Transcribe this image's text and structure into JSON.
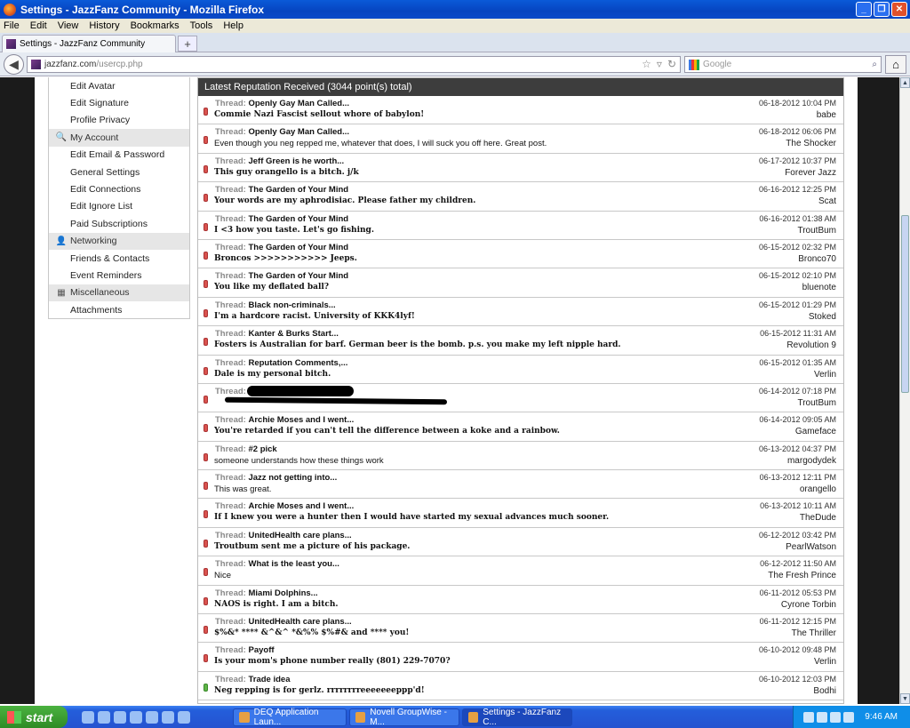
{
  "window": {
    "title": "Settings - JazzFanz Community - Mozilla Firefox"
  },
  "menu": [
    "File",
    "Edit",
    "View",
    "History",
    "Bookmarks",
    "Tools",
    "Help"
  ],
  "tab": {
    "label": "Settings - JazzFanz Community",
    "new_tab": "+"
  },
  "nav": {
    "url_domain": "jazzfanz.com",
    "url_path": "/usercp.php",
    "search_placeholder": "Google"
  },
  "sidebar": [
    {
      "label": "Edit Avatar",
      "head": false
    },
    {
      "label": "Edit Signature",
      "head": false
    },
    {
      "label": "Profile Privacy",
      "head": false
    },
    {
      "label": "My Account",
      "head": true,
      "icon": "key-icon"
    },
    {
      "label": "Edit Email & Password",
      "head": false
    },
    {
      "label": "General Settings",
      "head": false
    },
    {
      "label": "Edit Connections",
      "head": false
    },
    {
      "label": "Edit Ignore List",
      "head": false
    },
    {
      "label": "Paid Subscriptions",
      "head": false
    },
    {
      "label": "Networking",
      "head": true,
      "icon": "people-icon"
    },
    {
      "label": "Friends & Contacts",
      "head": false
    },
    {
      "label": "Event Reminders",
      "head": false
    },
    {
      "label": "Miscellaneous",
      "head": true,
      "icon": "misc-icon"
    },
    {
      "label": "Attachments",
      "head": false
    }
  ],
  "reputation": {
    "header": "Latest Reputation Received (3044 point(s) total)",
    "thread_label": "Thread:",
    "rows": [
      {
        "thread": "Openly Gay Man Called...",
        "message": "Commie Nazi Fascist sellout whore of babylon!",
        "date": "06-18-2012 10:04 PM",
        "user": "babe",
        "bold": true,
        "positive": false
      },
      {
        "thread": "Openly Gay Man Called...",
        "message": "Even though you neg repped me, whatever that does, I will suck you off here. Great post.",
        "date": "06-18-2012 06:06 PM",
        "user": "The Shocker",
        "bold": false,
        "positive": false
      },
      {
        "thread": "Jeff Green is he worth...",
        "message": "This guy orangello is a bitch. j/k",
        "date": "06-17-2012 10:37 PM",
        "user": "Forever Jazz",
        "bold": true,
        "positive": false
      },
      {
        "thread": "The Garden of Your Mind",
        "message": "Your words are my aphrodisiac. Please father my children.",
        "date": "06-16-2012 12:25 PM",
        "user": "Scat",
        "bold": true,
        "positive": false
      },
      {
        "thread": "The Garden of Your Mind",
        "message": "I <3 how you taste. Let's go fishing.",
        "date": "06-16-2012 01:38 AM",
        "user": "TroutBum",
        "bold": true,
        "positive": false
      },
      {
        "thread": "The Garden of Your Mind",
        "message": "Broncos >>>>>>>>>>> Jeeps.",
        "date": "06-15-2012 02:32 PM",
        "user": "Bronco70",
        "bold": true,
        "positive": false
      },
      {
        "thread": "The Garden of Your Mind",
        "message": "You like my deflated ball?",
        "date": "06-15-2012 02:10 PM",
        "user": "bluenote",
        "bold": true,
        "positive": false
      },
      {
        "thread": "Black non-criminals...",
        "message": "I'm a hardcore racist. University of KKK4lyf!",
        "date": "06-15-2012 01:29 PM",
        "user": "Stoked",
        "bold": true,
        "positive": false
      },
      {
        "thread": "Kanter & Burks Start...",
        "message": "Fosters is Australian for barf. German beer is the bomb. p.s. you make my left nipple hard.",
        "date": "06-15-2012 11:31 AM",
        "user": "Revolution 9",
        "bold": true,
        "positive": false
      },
      {
        "thread": "Reputation Comments,...",
        "message": "Dale is my personal bitch.",
        "date": "06-15-2012 01:35 AM",
        "user": "Verlin",
        "bold": true,
        "positive": false
      },
      {
        "thread": "",
        "message": "",
        "date": "06-14-2012 07:18 PM",
        "user": "TroutBum",
        "bold": true,
        "positive": false,
        "redacted": true
      },
      {
        "thread": "Archie Moses and I went...",
        "message": "You're retarded if you can't tell the difference between a koke and a rainbow.",
        "date": "06-14-2012 09:05 AM",
        "user": "Gameface",
        "bold": true,
        "positive": false
      },
      {
        "thread": "#2 pick",
        "message": "someone understands how these things work",
        "date": "06-13-2012 04:37 PM",
        "user": "margodydek",
        "bold": false,
        "positive": false
      },
      {
        "thread": "Jazz not getting into...",
        "message": "This was great.",
        "date": "06-13-2012 12:11 PM",
        "user": "orangello",
        "bold": false,
        "positive": false
      },
      {
        "thread": "Archie Moses and I went...",
        "message": "If I knew you were a hunter then I would have started my sexual advances much sooner.",
        "date": "06-13-2012 10:11 AM",
        "user": "TheDude",
        "bold": true,
        "positive": false
      },
      {
        "thread": "UnitedHealth care plans...",
        "message": "Troutbum sent me a picture of his package.",
        "date": "06-12-2012 03:42 PM",
        "user": "PearlWatson",
        "bold": true,
        "positive": false
      },
      {
        "thread": "What is the least you...",
        "message": "Nice",
        "date": "06-12-2012 11:50 AM",
        "user": "The Fresh Prince",
        "bold": false,
        "positive": false
      },
      {
        "thread": "Miami Dolphins...",
        "message": "NAOS is right. I am a bitch.",
        "date": "06-11-2012 05:53 PM",
        "user": "Cyrone Torbin",
        "bold": true,
        "positive": false
      },
      {
        "thread": "UnitedHealth care plans...",
        "message": "$%&* **** &^&^ *&%% $%#& and **** you!",
        "date": "06-11-2012 12:15 PM",
        "user": "The Thriller",
        "bold": true,
        "positive": false
      },
      {
        "thread": "Payoff",
        "message": "Is your mom's phone number really (801) 229-7070?",
        "date": "06-10-2012 09:48 PM",
        "user": "Verlin",
        "bold": true,
        "positive": false
      },
      {
        "thread": "Trade idea",
        "message": "Neg repping is for gerlz. rrrrrrrreeeeeeeppp'd!",
        "date": "06-10-2012 12:03 PM",
        "user": "Bodhi",
        "bold": true,
        "positive": true
      }
    ]
  },
  "taskbar": {
    "start": "start",
    "tasks": [
      {
        "label": "DEQ Application Laun...",
        "active": false
      },
      {
        "label": "Novell GroupWise - M...",
        "active": false
      },
      {
        "label": "Settings - JazzFanz C...",
        "active": true
      }
    ],
    "clock": "9:46 AM"
  }
}
